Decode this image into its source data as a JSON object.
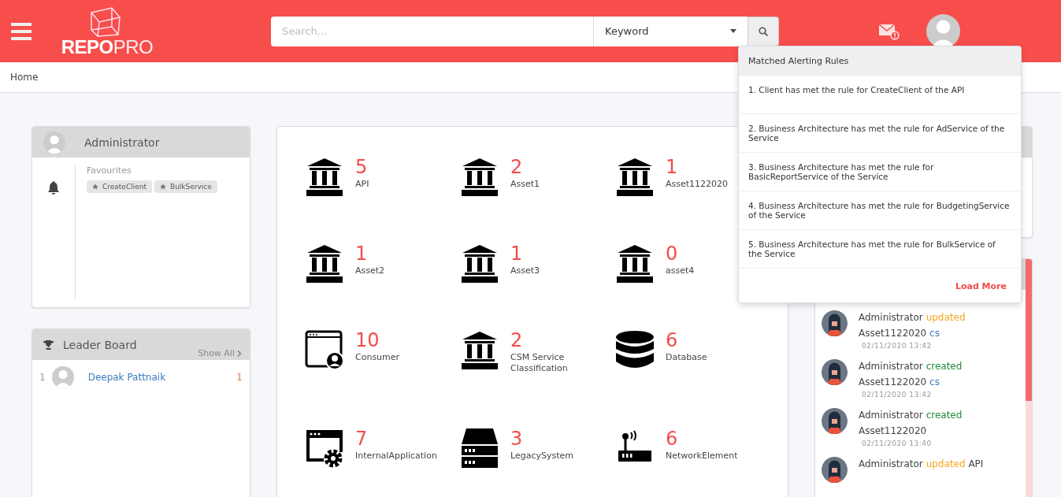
{
  "header": {
    "logo": {
      "bold": "REPO",
      "light": "PRO"
    },
    "search": {
      "placeholder": "Search...",
      "filter": "Keyword"
    }
  },
  "breadcrumb": [
    "Home"
  ],
  "profile": {
    "name": "Administrator",
    "favourites_label": "Favourites",
    "favourites": [
      "CreateClient",
      "BulkService"
    ]
  },
  "leader_board": {
    "title": "Leader Board",
    "show_all": "Show All",
    "rows": [
      {
        "rank": "1",
        "name": "Deepak Pattnaik",
        "score": "1"
      }
    ]
  },
  "assets": [
    {
      "kind": "bank",
      "count": "5",
      "name": "API"
    },
    {
      "kind": "bank",
      "count": "2",
      "name": "Asset1"
    },
    {
      "kind": "bank",
      "count": "1",
      "name": "Asset1122020"
    },
    {
      "kind": "bank",
      "count": "1",
      "name": "Asset2"
    },
    {
      "kind": "bank",
      "count": "1",
      "name": "Asset3"
    },
    {
      "kind": "bank",
      "count": "0",
      "name": "asset4"
    },
    {
      "kind": "consumer",
      "count": "10",
      "name": "Consumer"
    },
    {
      "kind": "bank",
      "count": "2",
      "name": "CSM Service Classification"
    },
    {
      "kind": "database",
      "count": "6",
      "name": "Database"
    },
    {
      "kind": "app",
      "count": "7",
      "name": "InternalApplication"
    },
    {
      "kind": "server",
      "count": "3",
      "name": "LegacySystem"
    },
    {
      "kind": "network",
      "count": "6",
      "name": "NetworkElement"
    }
  ],
  "activity": [
    {
      "actor": "Administrator",
      "verb": "updated",
      "kind": "updated",
      "target": "Asset1122020",
      "tag": "cs",
      "time": "02/11/2020 13:42"
    },
    {
      "actor": "Administrator",
      "verb": "created",
      "kind": "created",
      "target": "Asset1122020",
      "tag": "cs",
      "time": "02/11/2020 13:42"
    },
    {
      "actor": "Administrator",
      "verb": "created",
      "kind": "created",
      "target": "Asset1122020",
      "time": "02/11/2020 13:40"
    },
    {
      "actor": "Administrator",
      "verb": "updated",
      "kind": "updated",
      "target": "API"
    }
  ],
  "alerts": {
    "title": "Matched Alerting Rules",
    "items": [
      "1. Client has met the rule for CreateClient of the API",
      "2. Business Architecture has met the rule for AdService of the Service",
      "3. Business Architecture has met the rule for BasicReportService of the Service",
      "4. Business Architecture has met the rule for BudgetingService of the Service",
      "5. Business Architecture has met the rule for BulkService of the Service"
    ],
    "load_more": "Load More"
  }
}
